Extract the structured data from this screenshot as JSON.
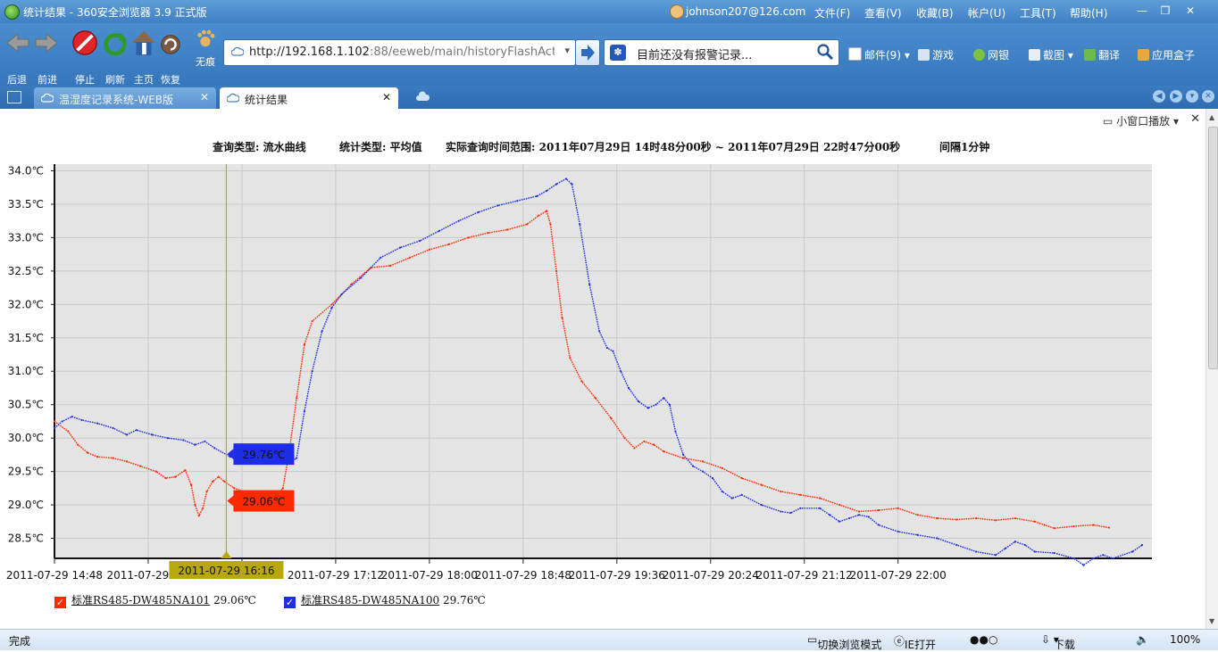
{
  "window": {
    "title": "统计结果 - 360安全浏览器 3.9 正式版",
    "user": "johnson207@126.com",
    "menu": [
      "文件(F)",
      "查看(V)",
      "收藏(B)",
      "帐户(U)",
      "工具(T)",
      "帮助(H)"
    ]
  },
  "toolbar": {
    "back": "后退",
    "forward": "前进",
    "stop": "停止",
    "refresh": "刷新",
    "home": "主页",
    "restore": "恢复",
    "no_trace": "无痕",
    "url_host": "http://192.168.1.102",
    "url_rest": ":88/eeweb/main/historyFlashAct",
    "search_text": "目前还没有报警记录...",
    "mail": "邮件(9)",
    "games": "游戏",
    "bank": "网银",
    "screenshot": "截图",
    "translate": "翻译",
    "app_box": "应用盒子"
  },
  "tabs": [
    {
      "label": "温湿度记录系统-WEB版",
      "active": false
    },
    {
      "label": "统计结果",
      "active": true
    }
  ],
  "content": {
    "popout": "小窗口播放",
    "query_type": "查询类型: 流水曲线",
    "stat_type": "统计类型: 平均值",
    "time_range": "实际查询时间范围: 2011年07月29日 14时48分00秒 ~ 2011年07月29日 22时47分00秒",
    "interval": "间隔1分钟"
  },
  "chart_data": {
    "type": "line",
    "ylim": [
      28.2,
      34.1
    ],
    "yticks": [
      "34.0℃",
      "33.5℃",
      "33.0℃",
      "32.5℃",
      "32.0℃",
      "31.5℃",
      "31.0℃",
      "30.5℃",
      "30.0℃",
      "29.5℃",
      "29.0℃",
      "28.5℃"
    ],
    "ytick_values": [
      34.0,
      33.5,
      33.0,
      32.5,
      32.0,
      31.5,
      31.0,
      30.5,
      30.0,
      29.5,
      29.0,
      28.5
    ],
    "xlim": [
      0,
      1228
    ],
    "xticks": [
      {
        "label": "2011-07-29 14:48",
        "t": "14:48"
      },
      {
        "label": "2011-07-29 15:",
        "t": "15:36"
      },
      {
        "label": "4",
        "t": "16:24"
      },
      {
        "label": "2011-07-29 17:12",
        "t": "17:12"
      },
      {
        "label": "2011-07-29 18:00",
        "t": "18:00"
      },
      {
        "label": "2011-07-29 18:48",
        "t": "18:48"
      },
      {
        "label": "2011-07-29 19:36",
        "t": "19:36"
      },
      {
        "label": "2011-07-29 20:24",
        "t": "20:24"
      },
      {
        "label": "2011-07-29 21:12",
        "t": "21:12"
      },
      {
        "label": "2011-07-29 22:00",
        "t": "22:00"
      }
    ],
    "cursor": {
      "time": "2011-07-29 16:16",
      "labels": [
        "29.76℃",
        "29.06℃"
      ]
    },
    "series": [
      {
        "name": "标准RS485-DW485NA101",
        "current": "29.06℃",
        "color": "#ff2a00",
        "points": [
          [
            "14:48",
            30.25
          ],
          [
            "14:55",
            30.1
          ],
          [
            "15:00",
            29.9
          ],
          [
            "15:05",
            29.78
          ],
          [
            "15:10",
            29.72
          ],
          [
            "15:18",
            29.7
          ],
          [
            "15:25",
            29.65
          ],
          [
            "15:32",
            29.58
          ],
          [
            "15:40",
            29.5
          ],
          [
            "15:45",
            29.4
          ],
          [
            "15:50",
            29.42
          ],
          [
            "15:55",
            29.52
          ],
          [
            "15:58",
            29.3
          ],
          [
            "16:00",
            29.0
          ],
          [
            "16:02",
            28.84
          ],
          [
            "16:04",
            28.95
          ],
          [
            "16:06",
            29.2
          ],
          [
            "16:09",
            29.35
          ],
          [
            "16:12",
            29.42
          ],
          [
            "16:15",
            29.35
          ],
          [
            "16:20",
            29.25
          ],
          [
            "16:25",
            29.2
          ],
          [
            "16:30",
            29.08
          ],
          [
            "16:35",
            29.06
          ],
          [
            "16:40",
            29.07
          ],
          [
            "16:45",
            29.25
          ],
          [
            "16:48",
            29.75
          ],
          [
            "16:52",
            30.6
          ],
          [
            "16:56",
            31.4
          ],
          [
            "17:00",
            31.75
          ],
          [
            "17:10",
            32.0
          ],
          [
            "17:20",
            32.3
          ],
          [
            "17:30",
            32.55
          ],
          [
            "17:40",
            32.58
          ],
          [
            "17:50",
            32.7
          ],
          [
            "18:00",
            32.82
          ],
          [
            "18:10",
            32.9
          ],
          [
            "18:20",
            33.0
          ],
          [
            "18:30",
            33.07
          ],
          [
            "18:40",
            33.12
          ],
          [
            "18:50",
            33.2
          ],
          [
            "18:56",
            33.33
          ],
          [
            "19:00",
            33.4
          ],
          [
            "19:02",
            33.2
          ],
          [
            "19:05",
            32.5
          ],
          [
            "19:08",
            31.8
          ],
          [
            "19:12",
            31.2
          ],
          [
            "19:18",
            30.85
          ],
          [
            "19:25",
            30.6
          ],
          [
            "19:33",
            30.3
          ],
          [
            "19:40",
            30.0
          ],
          [
            "19:45",
            29.85
          ],
          [
            "19:50",
            29.95
          ],
          [
            "19:55",
            29.9
          ],
          [
            "20:00",
            29.8
          ],
          [
            "20:10",
            29.7
          ],
          [
            "20:20",
            29.65
          ],
          [
            "20:30",
            29.55
          ],
          [
            "20:40",
            29.4
          ],
          [
            "20:50",
            29.3
          ],
          [
            "21:00",
            29.2
          ],
          [
            "21:10",
            29.15
          ],
          [
            "21:20",
            29.1
          ],
          [
            "21:30",
            29.0
          ],
          [
            "21:40",
            28.9
          ],
          [
            "21:50",
            28.92
          ],
          [
            "22:00",
            28.95
          ],
          [
            "22:10",
            28.85
          ],
          [
            "22:20",
            28.8
          ],
          [
            "22:30",
            28.78
          ],
          [
            "22:40",
            28.8
          ],
          [
            "22:50",
            28.77
          ],
          [
            "23:00",
            28.8
          ],
          [
            "23:10",
            28.75
          ],
          [
            "23:15",
            28.7
          ],
          [
            "23:20",
            28.65
          ],
          [
            "23:30",
            28.68
          ],
          [
            "23:40",
            28.7
          ],
          [
            "23:48",
            28.66
          ]
        ]
      },
      {
        "name": "标准RS485-DW485NA100",
        "current": "29.76℃",
        "color": "#1e2ee8",
        "points": [
          [
            "14:48",
            30.15
          ],
          [
            "14:52",
            30.25
          ],
          [
            "14:57",
            30.32
          ],
          [
            "15:02",
            30.27
          ],
          [
            "15:10",
            30.22
          ],
          [
            "15:18",
            30.15
          ],
          [
            "15:25",
            30.05
          ],
          [
            "15:30",
            30.12
          ],
          [
            "15:38",
            30.05
          ],
          [
            "15:46",
            30.0
          ],
          [
            "15:54",
            29.97
          ],
          [
            "16:00",
            29.9
          ],
          [
            "16:05",
            29.95
          ],
          [
            "16:10",
            29.85
          ],
          [
            "16:18",
            29.72
          ],
          [
            "16:25",
            29.7
          ],
          [
            "16:30",
            29.72
          ],
          [
            "16:36",
            29.76
          ],
          [
            "16:40",
            29.82
          ],
          [
            "16:44",
            29.7
          ],
          [
            "16:48",
            29.62
          ],
          [
            "16:52",
            29.7
          ],
          [
            "16:56",
            30.4
          ],
          [
            "17:00",
            31.0
          ],
          [
            "17:05",
            31.6
          ],
          [
            "17:10",
            31.95
          ],
          [
            "17:15",
            32.15
          ],
          [
            "17:25",
            32.4
          ],
          [
            "17:35",
            32.7
          ],
          [
            "17:45",
            32.85
          ],
          [
            "17:55",
            32.95
          ],
          [
            "18:05",
            33.1
          ],
          [
            "18:15",
            33.25
          ],
          [
            "18:25",
            33.38
          ],
          [
            "18:35",
            33.48
          ],
          [
            "18:45",
            33.55
          ],
          [
            "18:55",
            33.62
          ],
          [
            "19:00",
            33.7
          ],
          [
            "19:05",
            33.8
          ],
          [
            "19:10",
            33.88
          ],
          [
            "19:13",
            33.8
          ],
          [
            "19:17",
            33.2
          ],
          [
            "19:22",
            32.3
          ],
          [
            "19:27",
            31.6
          ],
          [
            "19:31",
            31.35
          ],
          [
            "19:34",
            31.3
          ],
          [
            "19:38",
            31.0
          ],
          [
            "19:42",
            30.75
          ],
          [
            "19:47",
            30.55
          ],
          [
            "19:52",
            30.45
          ],
          [
            "19:56",
            30.5
          ],
          [
            "20:00",
            30.6
          ],
          [
            "20:03",
            30.5
          ],
          [
            "20:06",
            30.1
          ],
          [
            "20:10",
            29.75
          ],
          [
            "20:15",
            29.58
          ],
          [
            "20:20",
            29.5
          ],
          [
            "20:25",
            29.4
          ],
          [
            "20:30",
            29.2
          ],
          [
            "20:35",
            29.1
          ],
          [
            "20:40",
            29.15
          ],
          [
            "20:50",
            29.0
          ],
          [
            "21:00",
            28.9
          ],
          [
            "21:05",
            28.88
          ],
          [
            "21:10",
            28.95
          ],
          [
            "21:20",
            28.95
          ],
          [
            "21:25",
            28.85
          ],
          [
            "21:30",
            28.75
          ],
          [
            "21:35",
            28.8
          ],
          [
            "21:40",
            28.85
          ],
          [
            "21:45",
            28.82
          ],
          [
            "21:50",
            28.7
          ],
          [
            "22:00",
            28.6
          ],
          [
            "22:10",
            28.55
          ],
          [
            "22:20",
            28.5
          ],
          [
            "22:30",
            28.4
          ],
          [
            "22:40",
            28.3
          ],
          [
            "22:50",
            28.25
          ],
          [
            "22:55",
            28.35
          ],
          [
            "23:00",
            28.45
          ],
          [
            "23:05",
            28.4
          ],
          [
            "23:10",
            28.3
          ],
          [
            "23:20",
            28.28
          ],
          [
            "23:30",
            28.2
          ],
          [
            "23:35",
            28.1
          ],
          [
            "23:40",
            28.2
          ],
          [
            "23:45",
            28.25
          ],
          [
            "23:50",
            28.2
          ],
          [
            "24:00",
            28.3
          ],
          [
            "24:05",
            28.4
          ]
        ]
      }
    ]
  },
  "status": {
    "left": "完成",
    "switch_mode": "切换浏览模式",
    "ie_open": "IE打开",
    "download": "下载",
    "zoom": "100%"
  }
}
